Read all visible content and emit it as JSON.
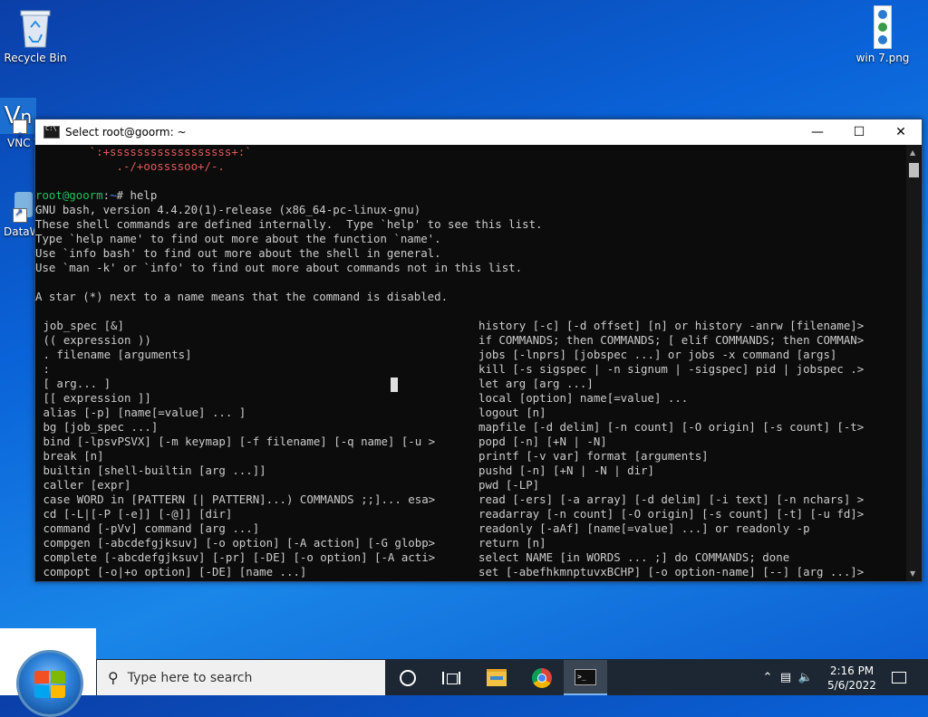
{
  "desktop": {
    "icons": [
      {
        "label": "Recycle Bin"
      },
      {
        "label": "VNC V"
      },
      {
        "label": "DataW"
      },
      {
        "label": "win 7.png"
      }
    ]
  },
  "window": {
    "title": "Select root@goorm: ~",
    "minimize": "—",
    "maximize": "☐",
    "close": "✕"
  },
  "console": {
    "ascii_lines": [
      "        `:+ssssssssssssssssss+:`",
      "            .-/+oossssoo+/-."
    ],
    "prompt_user": "root@goorm",
    "prompt_sep": ":",
    "prompt_path": "~",
    "prompt_cmd": "# help",
    "intro_lines": [
      "GNU bash, version 4.4.20(1)-release (x86_64-pc-linux-gnu)",
      "These shell commands are defined internally.  Type `help' to see this list.",
      "Type `help name' to find out more about the function `name'.",
      "Use `info bash' to find out more about the shell in general.",
      "Use `man -k' or `info' to find out more about commands not in this list.",
      "",
      "A star (*) next to a name means that the command is disabled.",
      ""
    ],
    "left_col": [
      " job_spec [&]",
      " (( expression ))",
      " . filename [arguments]",
      " :",
      " [ arg... ]",
      " [[ expression ]]",
      " alias [-p] [name[=value] ... ]",
      " bg [job_spec ...]",
      " bind [-lpsvPSVX] [-m keymap] [-f filename] [-q name] [-u >",
      " break [n]",
      " builtin [shell-builtin [arg ...]]",
      " caller [expr]",
      " case WORD in [PATTERN [| PATTERN]...) COMMANDS ;;]... esa>",
      " cd [-L|[-P [-e]] [-@]] [dir]",
      " command [-pVv] command [arg ...]",
      " compgen [-abcdefgjksuv] [-o option] [-A action] [-G globp>",
      " complete [-abcdefgjksuv] [-pr] [-DE] [-o option] [-A acti>",
      " compopt [-o|+o option] [-DE] [name ...]"
    ],
    "right_col": [
      "history [-c] [-d offset] [n] or history -anrw [filename]>",
      "if COMMANDS; then COMMANDS; [ elif COMMANDS; then COMMAN>",
      "jobs [-lnprs] [jobspec ...] or jobs -x command [args]",
      "kill [-s sigspec | -n signum | -sigspec] pid | jobspec .>",
      "let arg [arg ...]",
      "local [option] name[=value] ...",
      "logout [n]",
      "mapfile [-d delim] [-n count] [-O origin] [-s count] [-t>",
      "popd [-n] [+N | -N]",
      "printf [-v var] format [arguments]",
      "pushd [-n] [+N | -N | dir]",
      "pwd [-LP]",
      "read [-ers] [-a array] [-d delim] [-i text] [-n nchars] >",
      "readarray [-n count] [-O origin] [-s count] [-t] [-u fd]>",
      "readonly [-aAf] [name[=value] ...] or readonly -p",
      "return [n]",
      "select NAME [in WORDS ... ;] do COMMANDS; done",
      "set [-abefhkmnptuvxBCHP] [-o option-name] [--] [arg ...]>"
    ]
  },
  "taskbar": {
    "search_placeholder": "Type here to search",
    "time": "2:16 PM",
    "date": "5/6/2022",
    "icons": [
      "task-view-icon",
      "timeline-icon",
      "file-explorer-icon",
      "chrome-icon",
      "console-icon"
    ]
  },
  "colors": {
    "prompt_user": "#21c25e",
    "prompt_path": "#4a8ff0",
    "ascii": "#e05a5a",
    "console_bg": "#0c0c0c"
  }
}
